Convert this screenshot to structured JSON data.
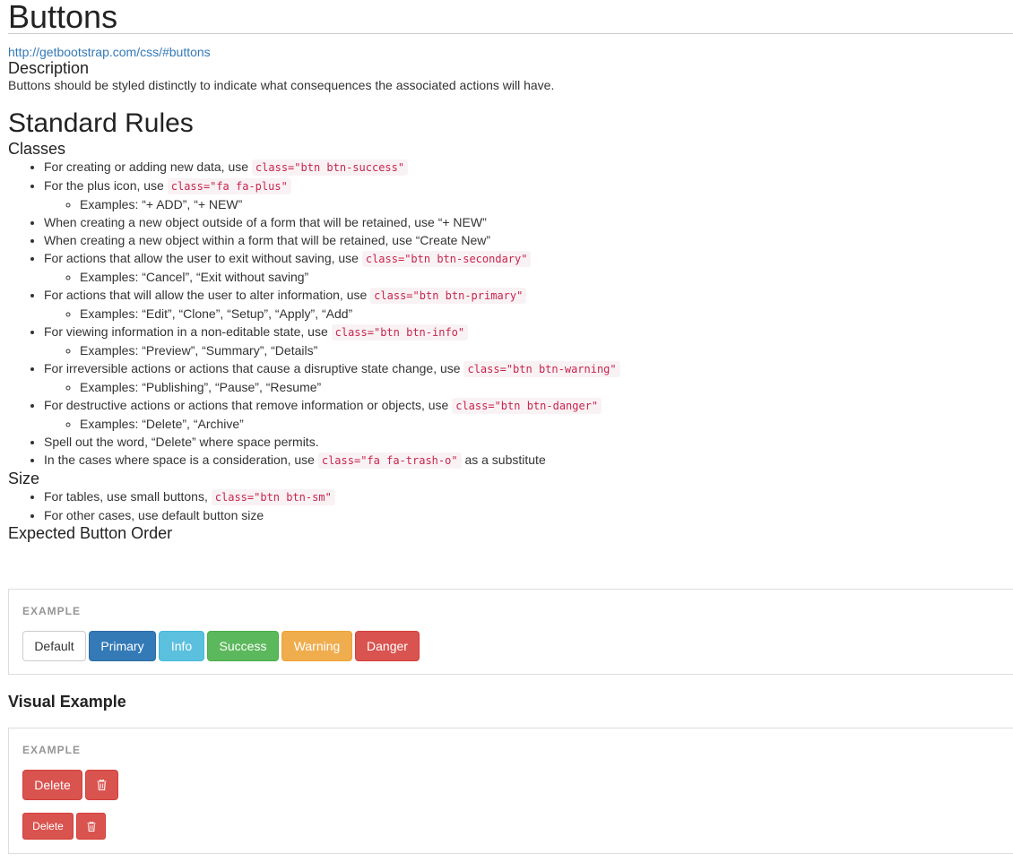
{
  "page": {
    "title": "Buttons",
    "link": "http://getbootstrap.com/css/#buttons"
  },
  "description": {
    "heading": "Description",
    "text": "Buttons should be styled distinctly to indicate what consequences the associated actions will have."
  },
  "standard_rules": {
    "heading": "Standard Rules",
    "classes_heading": "Classes",
    "rules": [
      {
        "text": "For creating or adding new data, use ",
        "code": "class=\"btn btn-success\"",
        "after": ""
      },
      {
        "text": "For the plus icon, use ",
        "code": "class=\"fa fa-plus\"",
        "after": ""
      },
      {
        "text": "Examples: “+ ADD”, “+ NEW”"
      },
      {
        "text": "When creating a new object outside of a form that will be retained, use “+ NEW”"
      },
      {
        "text": "When creating a new object within a form that will be retained, use “Create New”"
      },
      {
        "text": "For actions that allow the user to exit without saving, use ",
        "code": "class=\"btn btn-secondary\""
      },
      {
        "text": "Examples: “Cancel”, “Exit without saving”"
      },
      {
        "text": "For actions that will allow the user to alter information, use ",
        "code": "class=\"btn btn-primary\""
      },
      {
        "text": "Examples: “Edit”, “Clone”, “Setup”, “Apply”, “Add”"
      },
      {
        "text": "For viewing information in a non-editable state, use ",
        "code": "class=\"btn btn-info\""
      },
      {
        "text": "Examples: “Preview”, “Summary”, “Details”"
      },
      {
        "text": "For irreversible actions or actions that cause a disruptive state change, use ",
        "code": "class=\"btn btn-warning\""
      },
      {
        "text": "Examples: “Publishing”, “Pause”, “Resume”"
      },
      {
        "text": "For destructive actions or actions that remove information or objects, use ",
        "code": "class=\"btn btn-danger\""
      },
      {
        "text": "Examples: “Delete”, “Archive”"
      },
      {
        "text": "Spell out the word, “Delete” where space permits."
      },
      {
        "text": "In the cases where space is a consideration, use ",
        "code": "class=\"fa fa-trash-o\"",
        "after": " as a substitute"
      }
    ],
    "size_heading": "Size",
    "size_rules": [
      {
        "text": "For tables, use small buttons, ",
        "code": "class=\"btn btn-sm\""
      },
      {
        "text": "For other cases, use default button size"
      }
    ]
  },
  "button_order": {
    "heading": "Expected Button Order",
    "example_label": "EXAMPLE",
    "buttons": [
      "Default",
      "Primary",
      "Info",
      "Success",
      "Warning",
      "Danger"
    ]
  },
  "visual_example": {
    "heading": "Visual Example",
    "example_label": "EXAMPLE",
    "delete_label": "Delete",
    "delete_small_label": "Delete",
    "trash_icon": "trash-icon"
  },
  "colors": {
    "primary": "#337ab7",
    "info": "#5bc0de",
    "success": "#5cb85c",
    "warning": "#f0ad4e",
    "danger": "#d9534f",
    "code_text": "#c7254e",
    "code_bg": "#f9f2f4",
    "link": "#337ab7"
  }
}
